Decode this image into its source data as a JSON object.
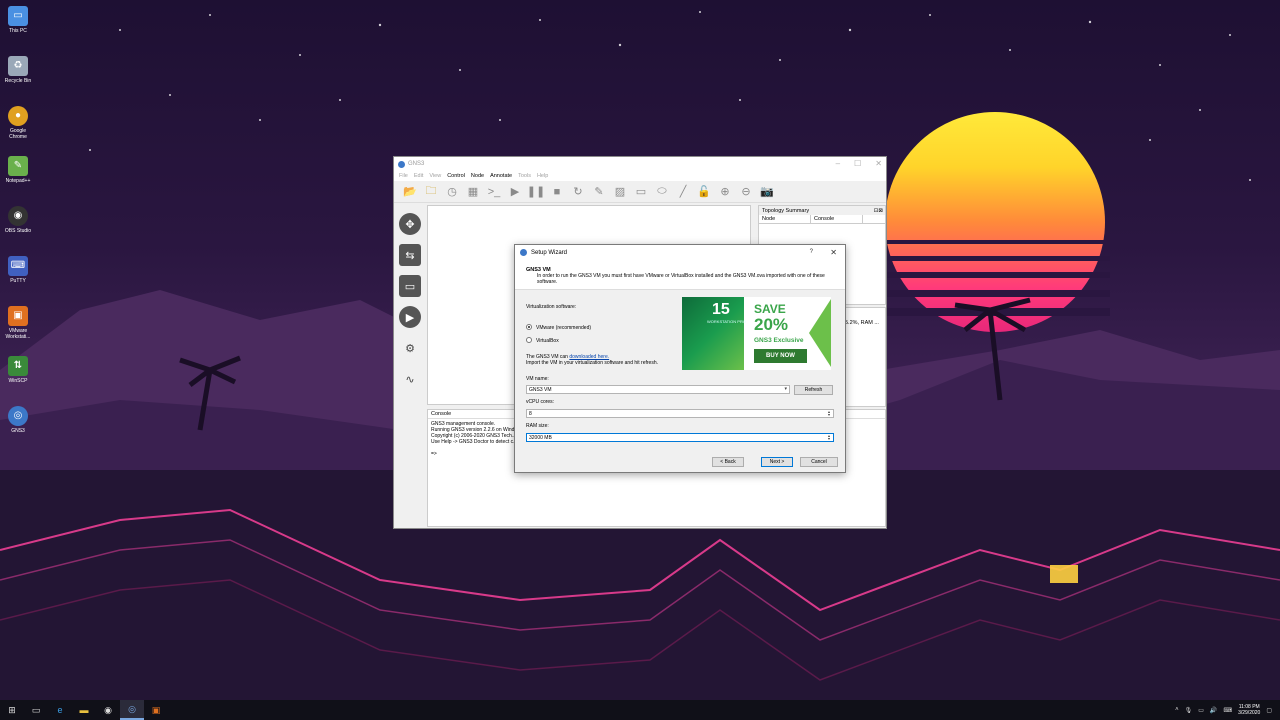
{
  "desktop": {
    "icons": [
      {
        "label": "This PC",
        "icon": "computer-icon",
        "color": "#4a90e2"
      },
      {
        "label": "Recycle Bin",
        "icon": "recycle-bin-icon",
        "color": "#9aa8b8"
      },
      {
        "label": "Google Chrome",
        "icon": "chrome-icon",
        "color": "#e0a020"
      },
      {
        "label": "Notepad++",
        "icon": "notepad-plus-icon",
        "color": "#6ab04c"
      },
      {
        "label": "OBS Studio",
        "icon": "obs-icon",
        "color": "#333333"
      },
      {
        "label": "PuTTY",
        "icon": "putty-icon",
        "color": "#4060c0"
      },
      {
        "label": "VMware Workstati...",
        "icon": "vmware-icon",
        "color": "#e07020"
      },
      {
        "label": "WinSCP",
        "icon": "winscp-icon",
        "color": "#3a8a3a"
      },
      {
        "label": "GNS3",
        "icon": "gns3-icon",
        "color": "#3c78c8"
      }
    ]
  },
  "gns3": {
    "title": "GNS3",
    "menu": [
      "File",
      "Edit",
      "View",
      "Control",
      "Node",
      "Annotate",
      "Tools",
      "Help"
    ],
    "topology": {
      "title": "Topology Summary",
      "col_node": "Node",
      "col_console": "Console"
    },
    "side_text": "5.2%, RAM ...",
    "console": {
      "title": "Console",
      "lines": [
        "GNS3 management console.",
        "Running GNS3 version 2.2.6 on Wind...",
        "Copyright (c) 2006-2020 GNS3 Tech...",
        "Use Help -> GNS3 Doctor to detect c..."
      ],
      "prompt": "=>"
    }
  },
  "wizard": {
    "title": "Setup Wizard",
    "help": "?",
    "close": "✕",
    "heading": "GNS3 VM",
    "description": "In order to run the GNS3 VM you must first have VMware or VirtualBox installed and the GNS3 VM.ova imported with one of these software.",
    "virt_label": "Virtualization software:",
    "options": [
      {
        "label": "VMware (recommended)",
        "selected": true
      },
      {
        "label": "VirtualBox",
        "selected": false
      }
    ],
    "download_text_pre": "The GNS3 VM can",
    "download_link": "downloaded here.",
    "import_text": "Import the VM in your virtualization software and hit refresh.",
    "vm_name_label": "VM name:",
    "vm_name_value": "GNS3 VM",
    "refresh": "Refresh",
    "vcpu_label": "vCPU cores:",
    "vcpu_value": "8",
    "ram_label": "RAM size:",
    "ram_value": "32000 MB",
    "back": "< Back",
    "next": "Next >",
    "cancel": "Cancel",
    "ad": {
      "version": "15",
      "product": "WORKSTATION PRO",
      "save": "SAVE",
      "percent": "20%",
      "exclusive": "GNS3 Exclusive",
      "buy": "BUY NOW"
    }
  },
  "taskbar": {
    "time": "11:08 PM",
    "date": "3/29/2020"
  }
}
